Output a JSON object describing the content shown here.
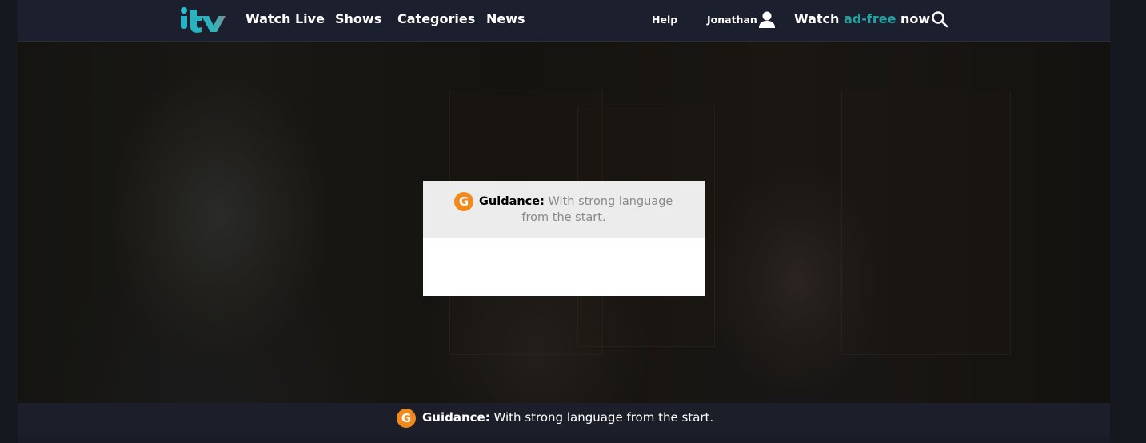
{
  "header": {
    "logo_text": "itv",
    "nav": [
      {
        "label": "Watch Live"
      },
      {
        "label": "Shows"
      },
      {
        "label": "Categories"
      },
      {
        "label": "News"
      }
    ],
    "help_label": "Help",
    "user_name": "Jonathan",
    "adfree": {
      "prefix": "Watch ",
      "accent": "ad-free",
      "suffix": " now"
    },
    "accent_color": "#22a2a2"
  },
  "modal": {
    "badge": "G",
    "heading": "Guidance:",
    "text_line1": " With strong language",
    "text_line2": "from the start."
  },
  "guidance_bar": {
    "badge": "G",
    "heading": "Guidance:",
    "text": " With strong language from the start."
  },
  "colors": {
    "badge": "#f18a1d",
    "header_bg": "#1c1f2e"
  }
}
